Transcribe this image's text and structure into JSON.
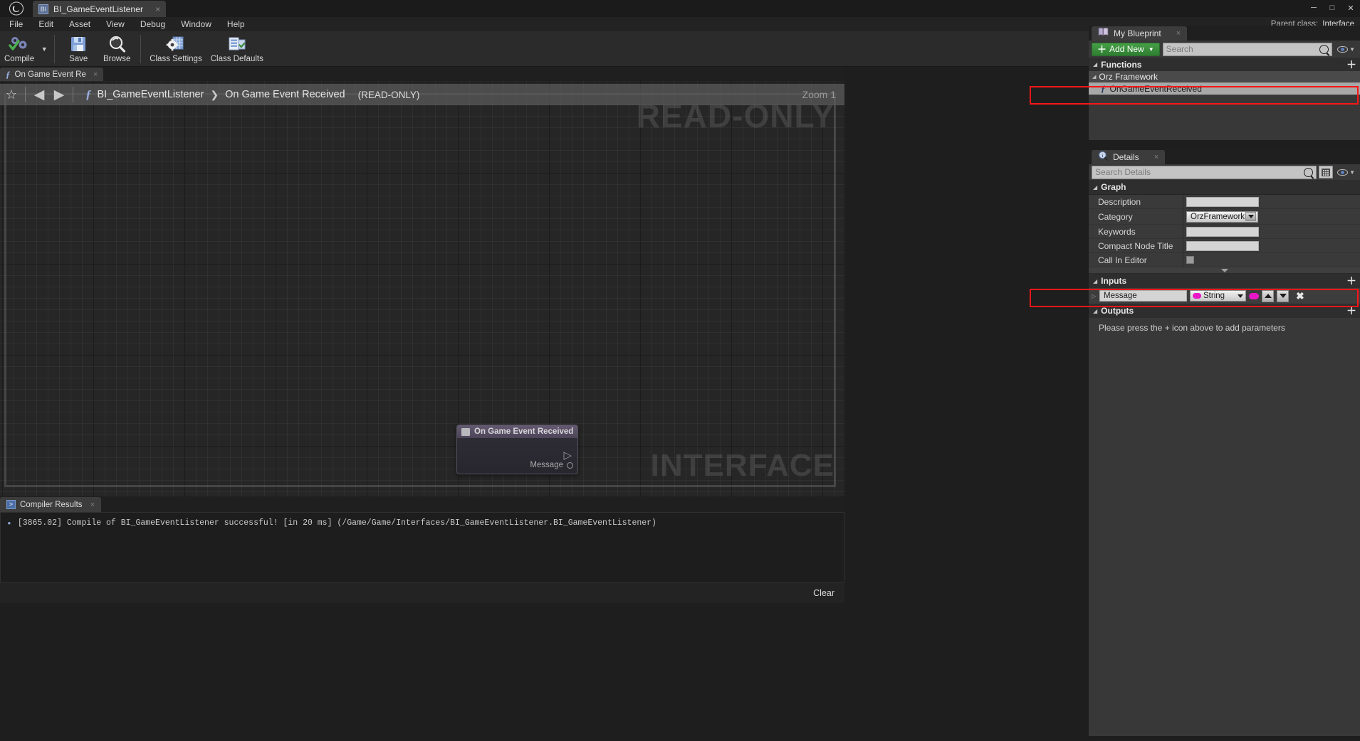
{
  "window": {
    "app_logo": "unreal-logo",
    "tab_title": "BI_GameEventListener",
    "tab_close": "×",
    "minimize": "─",
    "maximize": "□",
    "close": "✕"
  },
  "menubar": {
    "items": [
      "File",
      "Edit",
      "Asset",
      "View",
      "Debug",
      "Window",
      "Help"
    ],
    "parent_class_label": "Parent class:",
    "parent_class_value": "Interface"
  },
  "toolbar": {
    "compile_label": "Compile",
    "compile_caret": "▼",
    "save_label": "Save",
    "browse_label": "Browse",
    "class_settings_label": "Class Settings",
    "class_defaults_label": "Class Defaults"
  },
  "graph_tab": {
    "icon": "function-icon",
    "label": "On Game Event Re",
    "close": "×"
  },
  "breadcrumb": {
    "star_icon": "☆",
    "back_icon": "◀",
    "forward_icon": "▶",
    "fx_icon": "ƒ",
    "blueprint_name": "BI_GameEventListener",
    "separator": "❯",
    "graph_name": "On Game Event Received",
    "readonly_tag": "(READ-ONLY)",
    "zoom_label": "Zoom 1"
  },
  "graph": {
    "watermark_readonly": "READ-ONLY",
    "watermark_interface": "INTERFACE",
    "node": {
      "title": "On Game Event Received",
      "exec_pin": "▷",
      "output_pin_label": "Message"
    }
  },
  "compiler_results": {
    "tab_label": "Compiler Results",
    "tab_icon": "output-log-icon",
    "tab_close": "×",
    "bullet": "•",
    "message": "[3865.02] Compile of BI_GameEventListener successful! [in 20 ms] (/Game/Game/Interfaces/BI_GameEventListener.BI_GameEventListener)",
    "clear_label": "Clear"
  },
  "my_blueprint": {
    "tab_label": "My Blueprint",
    "tab_icon": "book-icon",
    "tab_close": "×",
    "add_new_label": "Add New",
    "add_new_plus": "＋",
    "add_new_caret": "▼",
    "search_placeholder": "Search",
    "search_value": "",
    "eye_caret": "▼",
    "functions_section": {
      "triangle": "◢",
      "label": "Functions",
      "add": "＋"
    },
    "category": {
      "triangle": "◢",
      "label": "Orz Framework"
    },
    "function_item": {
      "fx": "ƒ",
      "label": "OnGameEventReceived"
    }
  },
  "details": {
    "tab_label": "Details",
    "tab_icon": "info-icon",
    "tab_close": "×",
    "search_placeholder": "Search Details",
    "search_value": "",
    "eye_caret": "▼",
    "graph_section": {
      "triangle": "◢",
      "label": "Graph"
    },
    "rows": [
      {
        "name": "Description",
        "type": "text",
        "value": ""
      },
      {
        "name": "Category",
        "type": "combo",
        "value": "OrzFramework"
      },
      {
        "name": "Keywords",
        "type": "text",
        "value": ""
      },
      {
        "name": "Compact Node Title",
        "type": "text",
        "value": ""
      },
      {
        "name": "Call In Editor",
        "type": "checkbox",
        "value": ""
      }
    ],
    "inputs_section": {
      "triangle": "◢",
      "label": "Inputs",
      "add": "＋"
    },
    "input_param": {
      "expander": "▷",
      "name": "Message",
      "type": "String",
      "type_color": "#e817c8",
      "move_up": "▲",
      "move_down": "▼",
      "remove": "✖"
    },
    "outputs_section": {
      "triangle": "◢",
      "label": "Outputs",
      "add": "＋"
    },
    "outputs_empty_msg": "Please press the + icon above to add parameters"
  },
  "colors": {
    "accent_green": "#3a8a3a",
    "highlight_red": "#fb1616",
    "string_pink": "#e817c8",
    "panel_bg": "#383838",
    "graph_bg": "#262626"
  }
}
